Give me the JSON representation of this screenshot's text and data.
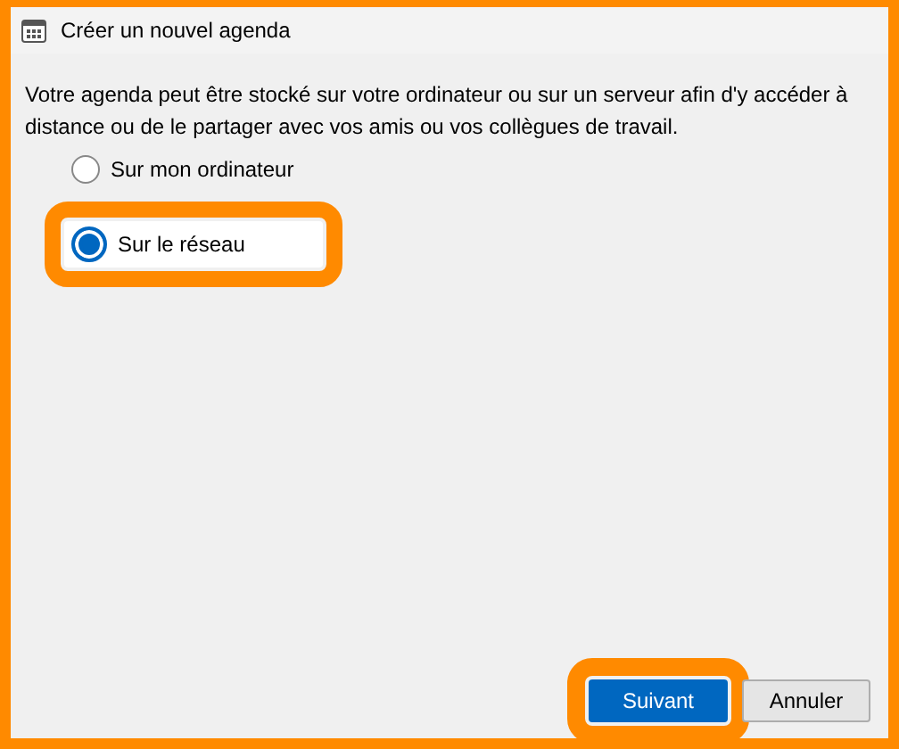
{
  "window": {
    "title": "Créer un nouvel agenda"
  },
  "description": "Votre agenda peut être stocké sur votre ordinateur ou sur un serveur afin d'y accéder à distance ou de le partager avec vos amis ou vos collègues de travail.",
  "options": [
    {
      "label": "Sur mon ordinateur",
      "selected": false,
      "highlighted": false
    },
    {
      "label": "Sur le réseau",
      "selected": true,
      "highlighted": true
    }
  ],
  "buttons": [
    {
      "label": "Suivant",
      "kind": "primary",
      "highlighted": true
    },
    {
      "label": "Annuler",
      "kind": "secondary",
      "highlighted": false
    }
  ]
}
